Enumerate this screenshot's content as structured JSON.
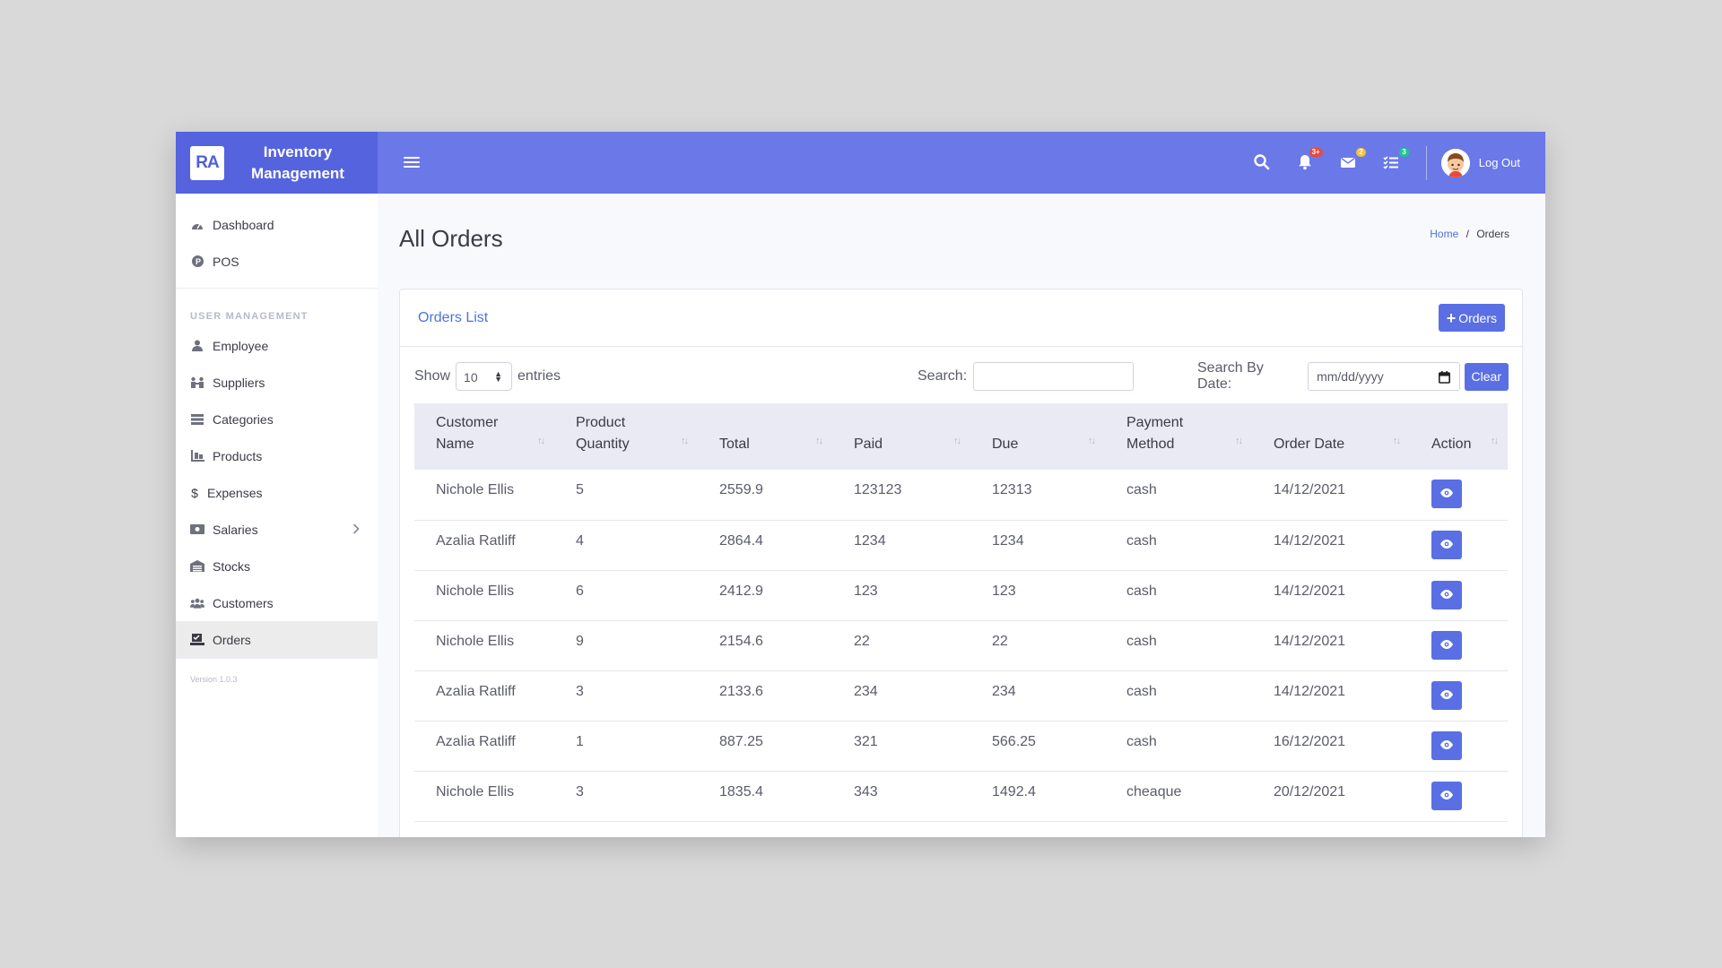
{
  "brand": {
    "logo_text": "RA",
    "name": "Inventory Management"
  },
  "topbar": {
    "notifications_badge": "3+",
    "messages_badge": "2",
    "tasks_badge": "3",
    "logout_label": "Log Out"
  },
  "sidebar": {
    "top_items": [
      {
        "label": "Dashboard",
        "icon": "tachometer-icon"
      },
      {
        "label": "POS",
        "icon": "pos-icon"
      }
    ],
    "section_heading": "USER MANAGEMENT",
    "items": [
      {
        "label": "Employee",
        "icon": "user-icon"
      },
      {
        "label": "Suppliers",
        "icon": "suppliers-icon"
      },
      {
        "label": "Categories",
        "icon": "list-icon"
      },
      {
        "label": "Products",
        "icon": "products-icon"
      },
      {
        "label": "Expenses",
        "icon": "dollar-icon"
      },
      {
        "label": "Salaries",
        "icon": "money-icon"
      },
      {
        "label": "Stocks",
        "icon": "warehouse-icon"
      },
      {
        "label": "Customers",
        "icon": "users-icon"
      },
      {
        "label": "Orders",
        "icon": "orders-icon",
        "active": true
      }
    ],
    "version": "Version 1.0.3"
  },
  "page": {
    "title": "All Orders",
    "breadcrumb_home": "Home",
    "breadcrumb_sep": "/",
    "breadcrumb_current": "Orders"
  },
  "card": {
    "title": "Orders List",
    "add_button": "Orders",
    "show_label": "Show",
    "entries_value": "10",
    "entries_label": "entries",
    "search_label": "Search:",
    "search_value": "",
    "date_label": "Search By Date:",
    "date_placeholder": "mm/dd/yyyy",
    "clear_button": "Clear"
  },
  "table": {
    "columns": [
      {
        "line1": "Customer",
        "line2": "Name"
      },
      {
        "line1": "Product",
        "line2": "Quantity"
      },
      {
        "line1": "",
        "line2": "Total"
      },
      {
        "line1": "",
        "line2": "Paid"
      },
      {
        "line1": "",
        "line2": "Due"
      },
      {
        "line1": "Payment",
        "line2": "Method"
      },
      {
        "line1": "",
        "line2": "Order Date"
      },
      {
        "line1": "",
        "line2": "Action"
      }
    ],
    "rows": [
      [
        "Nichole Ellis",
        "5",
        "2559.9",
        "123123",
        "12313",
        "cash",
        "14/12/2021"
      ],
      [
        "Azalia Ratliff",
        "4",
        "2864.4",
        "1234",
        "1234",
        "cash",
        "14/12/2021"
      ],
      [
        "Nichole Ellis",
        "6",
        "2412.9",
        "123",
        "123",
        "cash",
        "14/12/2021"
      ],
      [
        "Nichole Ellis",
        "9",
        "2154.6",
        "22",
        "22",
        "cash",
        "14/12/2021"
      ],
      [
        "Azalia Ratliff",
        "3",
        "2133.6",
        "234",
        "234",
        "cash",
        "14/12/2021"
      ],
      [
        "Azalia Ratliff",
        "1",
        "887.25",
        "321",
        "566.25",
        "cash",
        "16/12/2021"
      ],
      [
        "Nichole Ellis",
        "3",
        "1835.4",
        "343",
        "1492.4",
        "cheaque",
        "20/12/2021"
      ]
    ]
  },
  "colors": {
    "primary": "#6a78e8",
    "brand_dark": "#5563df",
    "button": "#5a6fe3",
    "link": "#4e73df"
  }
}
